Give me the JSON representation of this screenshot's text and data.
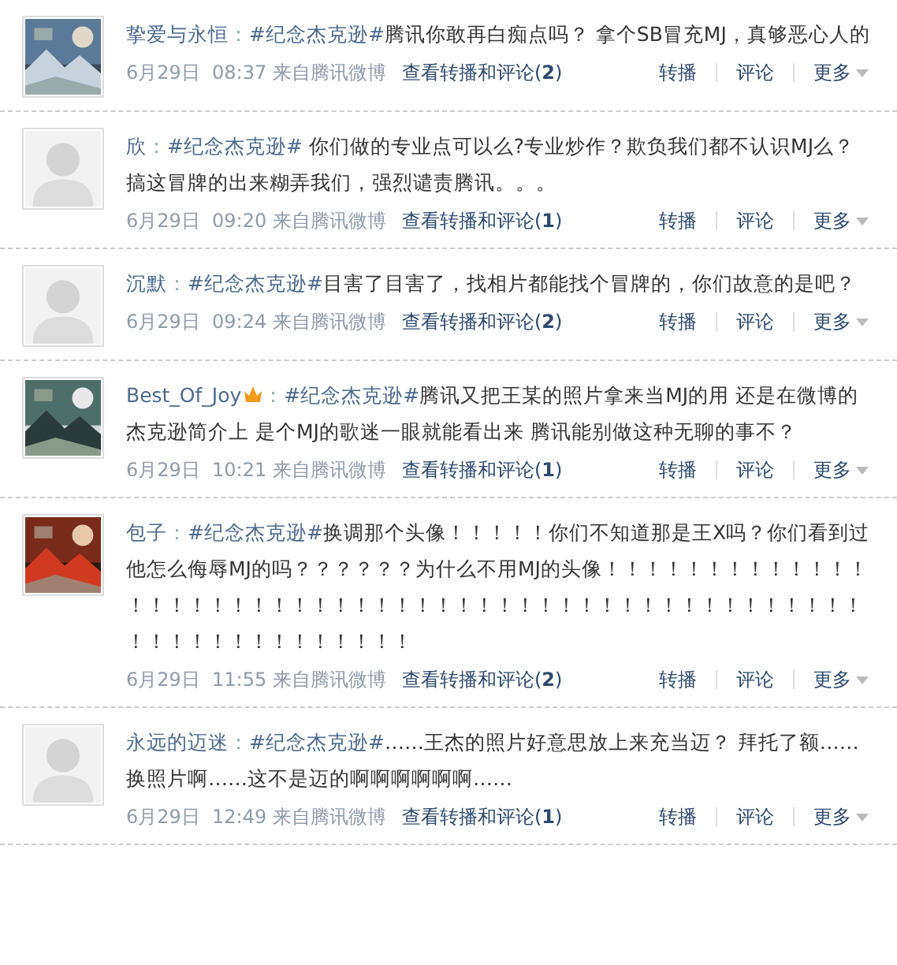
{
  "posts": [
    {
      "author": "挚爱与永恒",
      "badge": false,
      "colon": "：",
      "hashtag": "#纪念杰克逊#",
      "text": "腾讯你敢再白痴点吗？  拿个SB冒充MJ，真够恶心人的",
      "time": "6月29日  08:37 来自腾讯微博",
      "replies": "查看转播和评论(**2**)",
      "actions": [
        "转播",
        "评论",
        "更多"
      ]
    },
    {
      "kind": "default",
      "author": "欣",
      "badge": false,
      "colon": "：",
      "hashtag": "#纪念杰克逊#",
      "text": " 你们做的专业点可以么?专业炒作？欺负我们都不认识MJ么？搞这冒牌的出来糊弄我们，强烈谴责腾讯。。。",
      "time": "6月29日  09:20 来自腾讯微博",
      "replies": "查看转播和评论(**1**)",
      "actions": [
        "转播",
        "评论",
        "更多"
      ]
    },
    {
      "kind": "default",
      "author": "沉默",
      "badge": false,
      "colon": "：",
      "hashtag": "#纪念杰克逊#",
      "text": "目害了目害了，找相片都能找个冒牌的，你们故意的是吧？",
      "time": "6月29日  09:24 来自腾讯微博",
      "replies": "查看转播和评论(**2**)",
      "actions": [
        "转播",
        "评论",
        "更多"
      ]
    },
    {
      "author": "Best_Of_Joy",
      "badge": true,
      "colon": "：",
      "hashtag": "#纪念杰克逊#",
      "text": "腾讯又把王某的照片拿来当MJ的用  还是在微博的杰克逊简介上  是个MJ的歌迷一眼就能看出来  腾讯能别做这种无聊的事不？",
      "time": "6月29日  10:21 来自腾讯微博",
      "replies": "查看转播和评论(**1**)",
      "actions": [
        "转播",
        "评论",
        "更多"
      ]
    },
    {
      "author": "包子",
      "badge": false,
      "colon": "：",
      "hashtag": "#纪念杰克逊#",
      "text": "换调那个头像！！！！！你们不知道那是王X吗？你们看到过他怎么侮辱MJ的吗？？？？？？为什么不用MJ的头像！！！！！！！！！！！！！！！！！！！！！！！！！！！！！！！！！！！！！！！！！！！！！！！！！！！！！！！！！！！！！！！",
      "time": "6月29日  11:55 来自腾讯微博",
      "replies": "查看转播和评论(**2**)",
      "actions": [
        "转播",
        "评论",
        "更多"
      ]
    },
    {
      "kind": "default",
      "author": "永远的迈迷",
      "badge": false,
      "colon": "：",
      "hashtag": "#纪念杰克逊#",
      "text": "……王杰的照片好意思放上来充当迈？  拜托了额……换照片啊……这不是迈的啊啊啊啊啊啊……",
      "time": "6月29日  12:49 来自腾讯微博",
      "replies": "查看转播和评论(**1**)",
      "actions": [
        "转播",
        "评论",
        "更多"
      ]
    }
  ]
}
